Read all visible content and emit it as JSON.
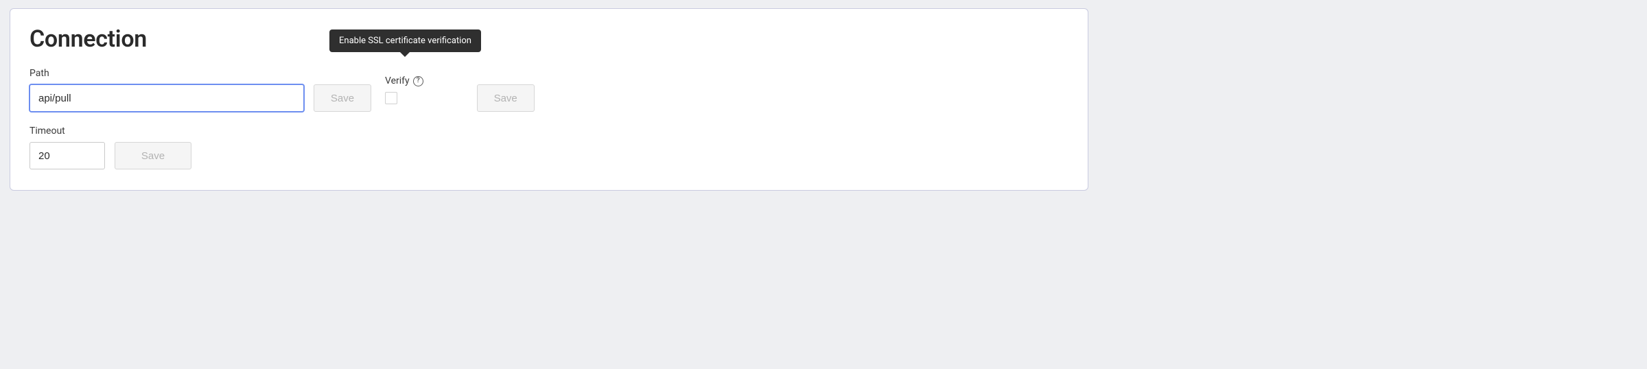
{
  "section": {
    "title": "Connection"
  },
  "fields": {
    "path": {
      "label": "Path",
      "value": "api/pull"
    },
    "verify": {
      "label": "Verify",
      "tooltip": "Enable SSL certificate verification",
      "checked": false
    },
    "timeout": {
      "label": "Timeout",
      "value": "20"
    }
  },
  "buttons": {
    "save": "Save"
  }
}
